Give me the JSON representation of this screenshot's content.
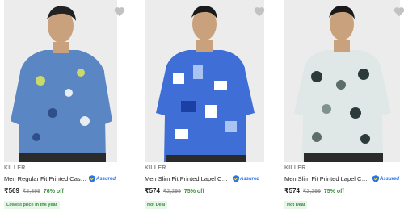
{
  "products": [
    {
      "brand": "KILLER",
      "title": "Men Regular Fit Printed Casual S...",
      "assured_label": "Assured",
      "price": "₹569",
      "mrp": "₹2,399",
      "discount": "76% off",
      "badge": "Lowest price in the year",
      "shirt_color": "#5a86c4"
    },
    {
      "brand": "KILLER",
      "title": "Men Slim Fit Printed Lapel Collar...",
      "assured_label": "Assured",
      "price": "₹574",
      "mrp": "₹2,299",
      "discount": "75% off",
      "badge": "Hot Deal",
      "shirt_color": "#3f6fd6"
    },
    {
      "brand": "KILLER",
      "title": "Men Slim Fit Printed Lapel Collar...",
      "assured_label": "Assured",
      "price": "₹574",
      "mrp": "₹2,299",
      "discount": "75% off",
      "badge": "Hot Deal",
      "shirt_color": "#dfe8e6"
    }
  ],
  "colors": {
    "price_green": "#388e3c",
    "assured_blue": "#2874f0",
    "badge_bg": "#e8f5e9",
    "wishlist_heart": "#c2c2c2"
  },
  "icons": [
    "wishlist-heart-icon",
    "assured-shield-icon"
  ]
}
